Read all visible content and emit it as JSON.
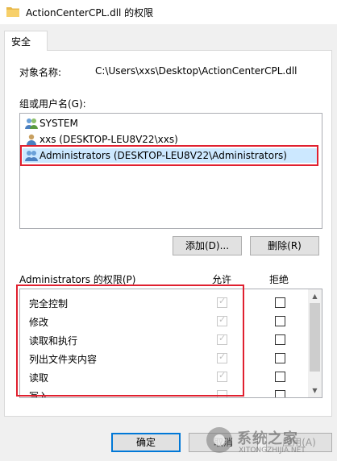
{
  "window": {
    "title": "ActionCenterCPL.dll 的权限"
  },
  "tabs": [
    {
      "label": "安全"
    }
  ],
  "object": {
    "label": "对象名称:",
    "path": "C:\\Users\\xxs\\Desktop\\ActionCenterCPL.dll"
  },
  "groups": {
    "label": "组或用户名(G):",
    "items": [
      {
        "name": "SYSTEM",
        "icon": "users-icon"
      },
      {
        "name": "xxs (DESKTOP-LEU8V22\\xxs)",
        "icon": "user-icon"
      },
      {
        "name": "Administrators (DESKTOP-LEU8V22\\Administrators)",
        "icon": "users-icon",
        "selected": true
      }
    ]
  },
  "buttons": {
    "add": "添加(D)...",
    "remove": "删除(R)",
    "ok": "确定",
    "cancel": "取消",
    "apply": "应用(A)"
  },
  "permissions": {
    "label": "Administrators 的权限(P)",
    "allow_header": "允许",
    "deny_header": "拒绝",
    "rows": [
      {
        "name": "完全控制",
        "allow": true,
        "deny": false
      },
      {
        "name": "修改",
        "allow": true,
        "deny": false
      },
      {
        "name": "读取和执行",
        "allow": true,
        "deny": false
      },
      {
        "name": "列出文件夹内容",
        "allow": true,
        "deny": false
      },
      {
        "name": "读取",
        "allow": true,
        "deny": false
      },
      {
        "name": "写入",
        "allow": false,
        "deny": false
      }
    ]
  },
  "highlight_color": "#e0202f",
  "selection_color": "#cce8ff",
  "watermark": {
    "text": "系统之家",
    "url": "XITONGZHIJIA.NET"
  }
}
